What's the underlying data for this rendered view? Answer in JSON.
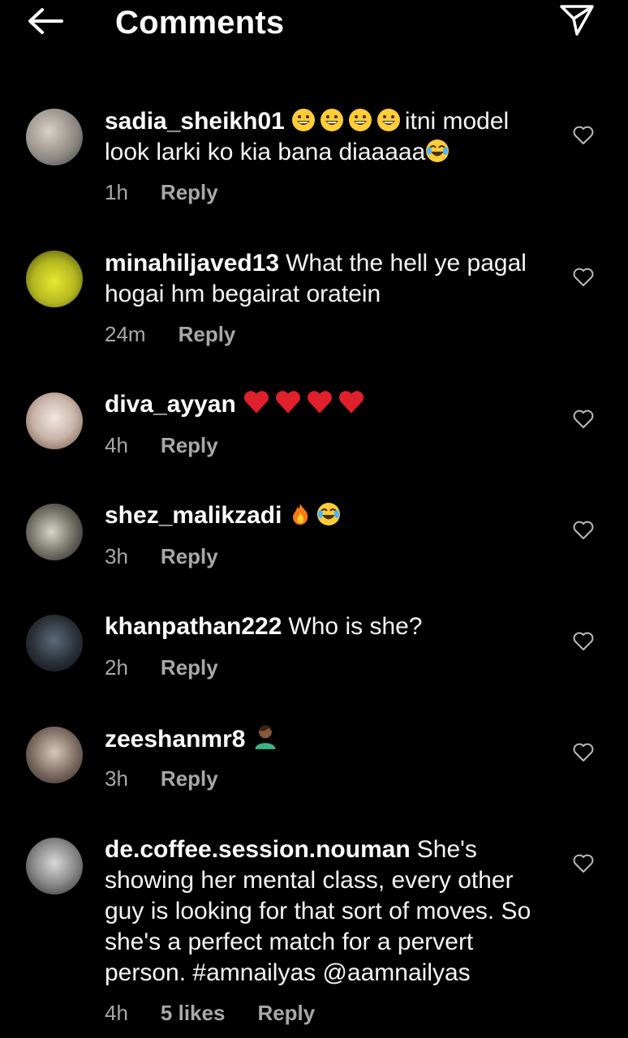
{
  "header": {
    "title": "Comments",
    "back_icon": "arrow-left-icon",
    "share_icon": "paper-plane-icon"
  },
  "comments": [
    {
      "username": "sadia_sheikh01",
      "text_before": "",
      "emoji_prefix": [
        "grinning",
        "grinning",
        "grinning",
        "grinning"
      ],
      "text": "itni model look larki ko kia bana diaaaaa",
      "emoji_suffix": [
        "joy"
      ],
      "time": "1h",
      "likes": "",
      "reply_label": "Reply"
    },
    {
      "username": "minahiljaved13",
      "text": "What the hell ye pagal hogai hm begairat oratein",
      "time": "24m",
      "likes": "",
      "reply_label": "Reply"
    },
    {
      "username": "diva_ayyan",
      "text": "",
      "emoji_prefix": [
        "heart",
        "heart",
        "heart",
        "heart"
      ],
      "time": "4h",
      "likes": "",
      "reply_label": "Reply"
    },
    {
      "username": "shez_malikzadi",
      "text": "",
      "emoji_prefix": [
        "fire",
        "joy"
      ],
      "time": "3h",
      "likes": "",
      "reply_label": "Reply"
    },
    {
      "username": "khanpathan222",
      "text": "Who is she?",
      "time": "2h",
      "likes": "",
      "reply_label": "Reply"
    },
    {
      "username": "zeeshanmr8",
      "text": "",
      "emoji_prefix": [
        "facepalm"
      ],
      "time": "3h",
      "likes": "",
      "reply_label": "Reply"
    },
    {
      "username": "de.coffee.session.nouman",
      "text": "She's showing her mental class, every other guy is looking for that sort of moves. So she's a perfect match for a pervert person. #amnailyas @aamnailyas",
      "time": "4h",
      "likes": "5 likes",
      "reply_label": "Reply"
    }
  ],
  "colors": {
    "background": "#000000",
    "text": "#ffffff",
    "meta": "#a8a8a8"
  }
}
